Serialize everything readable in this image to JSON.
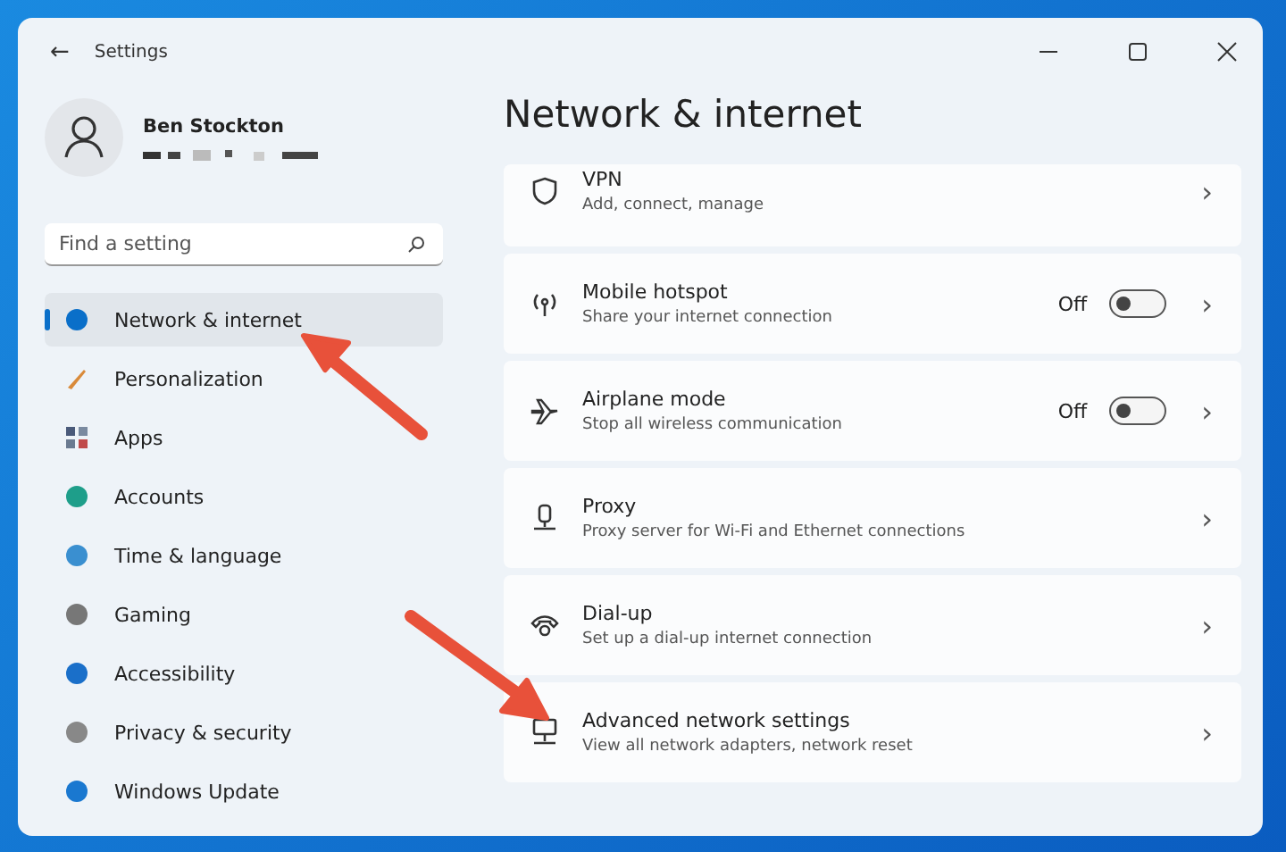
{
  "window": {
    "title": "Settings",
    "back": "←"
  },
  "profile": {
    "name": "Ben Stockton"
  },
  "search": {
    "placeholder": "Find a setting"
  },
  "sidebar": {
    "items": [
      {
        "label": "Network & internet",
        "selected": true
      },
      {
        "label": "Personalization",
        "selected": false
      },
      {
        "label": "Apps",
        "selected": false
      },
      {
        "label": "Accounts",
        "selected": false
      },
      {
        "label": "Time & language",
        "selected": false
      },
      {
        "label": "Gaming",
        "selected": false
      },
      {
        "label": "Accessibility",
        "selected": false
      },
      {
        "label": "Privacy & security",
        "selected": false
      },
      {
        "label": "Windows Update",
        "selected": false
      }
    ]
  },
  "page": {
    "title": "Network & internet"
  },
  "settings": [
    {
      "title": "VPN",
      "subtitle": "Add, connect, manage",
      "chevron": "›"
    },
    {
      "title": "Mobile hotspot",
      "subtitle": "Share your internet connection",
      "chevron": "›",
      "toggle": {
        "label": "Off",
        "on": false
      }
    },
    {
      "title": "Airplane mode",
      "subtitle": "Stop all wireless communication",
      "chevron": "›",
      "toggle": {
        "label": "Off",
        "on": false
      }
    },
    {
      "title": "Proxy",
      "subtitle": "Proxy server for Wi-Fi and Ethernet connections",
      "chevron": "›"
    },
    {
      "title": "Dial-up",
      "subtitle": "Set up a dial-up internet connection",
      "chevron": "›"
    },
    {
      "title": "Advanced network settings",
      "subtitle": "View all network adapters, network reset",
      "chevron": "›"
    }
  ]
}
